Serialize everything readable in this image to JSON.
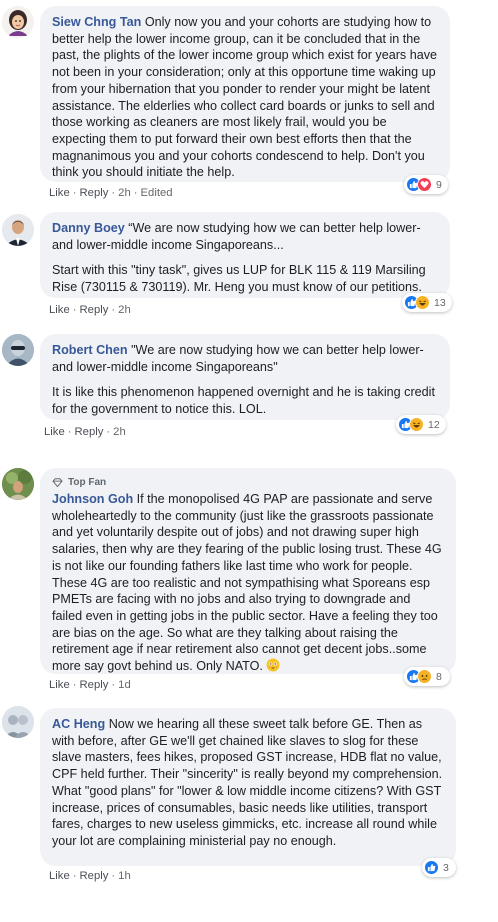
{
  "comments": [
    {
      "author": "Siew Chng Tan",
      "paragraphs": [
        "Only now you and your cohorts are studying how to better help the lower income group, can it be concluded that in the past, the plights of the lower income group which exist for years have not been in your consideration; only at this opportune time waking up from your hibernation that you ponder to render your might be latent assistance. The elderlies who collect card boards or junks to sell and those working as cleaners are most likely frail, would you be expecting them to put forward their own best efforts then that the magnanimous you and your cohorts condescend to help. Don't you think you should initiate the help."
      ],
      "like": "Like",
      "reply": "Reply",
      "time": "2h",
      "edited": "Edited",
      "reaction_icons": [
        "like-icon",
        "love-icon"
      ],
      "reaction_count": "9"
    },
    {
      "author": "Danny Boey",
      "paragraphs": [
        "“We are now studying how we can better help lower- and lower-middle income Singaporeans...",
        "Start with this \"tiny task\", gives us LUP for BLK 115 & 119 Marsiling Rise (730115 & 730119). Mr. Heng you must know of our petitions."
      ],
      "like": "Like",
      "reply": "Reply",
      "time": "2h",
      "reaction_icons": [
        "like-icon",
        "haha-icon"
      ],
      "reaction_count": "13"
    },
    {
      "author": "Robert Chen",
      "paragraphs": [
        "\"We are now studying how we can better help lower- and lower-middle income Singaporeans\"",
        "It is like this phenomenon happened overnight and he is taking credit for the government to notice this. LOL."
      ],
      "like": "Like",
      "reply": "Reply",
      "time": "2h",
      "reaction_icons": [
        "like-icon",
        "haha-icon"
      ],
      "reaction_count": "12"
    },
    {
      "badge": "Top Fan",
      "author": "Johnson Goh",
      "paragraphs": [
        "If the monopolised 4G PAP are passionate and serve wholeheartedly to the community (just like the grassroots passionate and yet voluntarily despite out of jobs) and not drawing super high salaries, then why are they fearing of the public losing trust. These 4G is not like our founding fathers like last time who work for people. These 4G are too realistic and not sympathising what Sporeans esp PMETs are facing with no jobs and also trying to downgrade and failed even in getting jobs in the public sector. Have a feeling they too are bias on the age. So what are they talking about raising the retirement age if near retirement also cannot get decent jobs..some more say govt behind us. Only NATO."
      ],
      "like": "Like",
      "reply": "Reply",
      "time": "1d",
      "reaction_icons": [
        "like-icon",
        "sad-icon"
      ],
      "reaction_count": "8"
    },
    {
      "author": "AC Heng",
      "paragraphs": [
        "Now we hearing all these sweet talk before GE. Then as with before, after GE we'll get chained like slaves to slog for these slave masters, fees hikes, proposed GST increase, HDB flat no value, CPF held further. Their \"sincerity\" is really beyond my comprehension. What \"good plans\" for \"lower & low middle income citizens? With GST increase, prices of consumables, basic needs like utilities, transport fares, charges to new useless gimmicks, etc. increase all round while your lot are complaining ministerial pay no enough."
      ],
      "like": "Like",
      "reply": "Reply",
      "time": "1h",
      "reaction_icons": [
        "like-icon"
      ],
      "reaction_count": "3"
    }
  ],
  "colors": {
    "author": "#385898",
    "bubble": "#f0f2f5",
    "like_reaction": "#1877f2",
    "love_reaction": "#f33e58",
    "haha_reaction": "#f7b125"
  }
}
